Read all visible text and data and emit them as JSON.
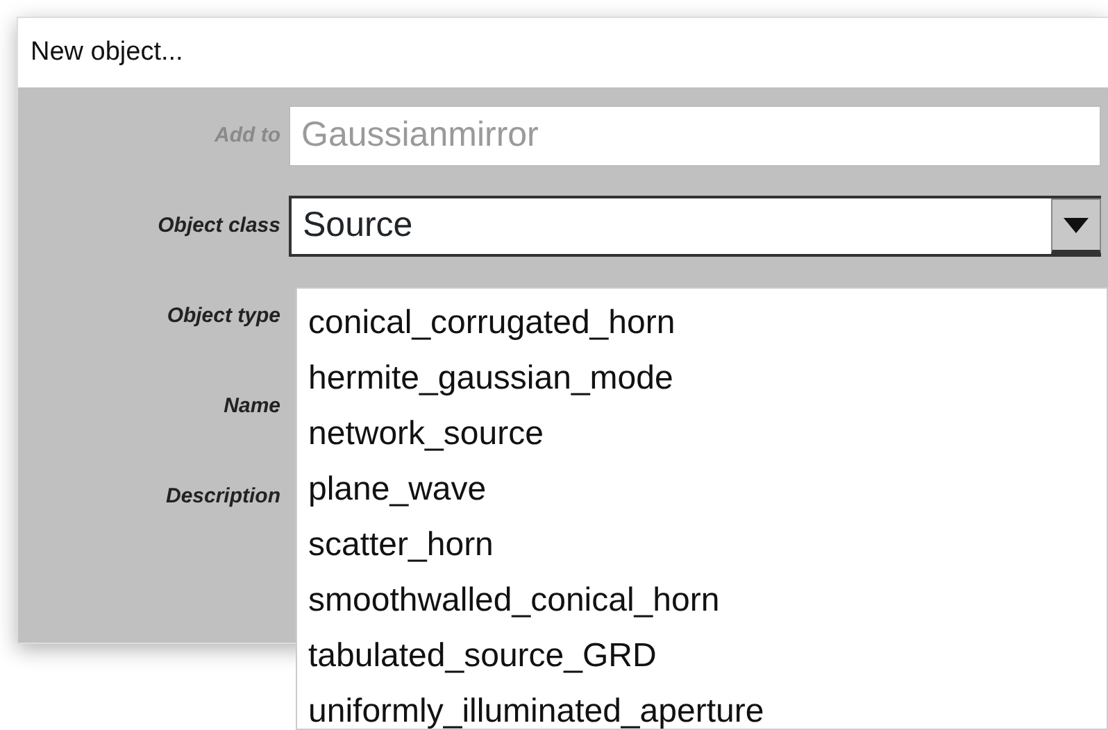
{
  "window": {
    "title": "New object..."
  },
  "fields": [
    {
      "label": "Add to",
      "kind": "text",
      "value": "Gaussianmirror",
      "disabled": true
    },
    {
      "label": "Object class",
      "kind": "select",
      "value": "Source",
      "disabled": false
    },
    {
      "label": "Object type",
      "kind": "covered",
      "disabled": false
    },
    {
      "label": "Name",
      "kind": "covered",
      "disabled": false
    },
    {
      "label": "Description",
      "kind": "covered",
      "disabled": false
    }
  ],
  "dropdown": {
    "items": [
      {
        "label": "conical_corrugated_horn",
        "selected": false
      },
      {
        "label": "hermite_gaussian_mode",
        "selected": false
      },
      {
        "label": "network_source",
        "selected": false
      },
      {
        "label": "plane_wave",
        "selected": false
      },
      {
        "label": "scatter_horn",
        "selected": false
      },
      {
        "label": "smoothwalled_conical_horn",
        "selected": false
      },
      {
        "label": "tabulated_source_GRD",
        "selected": false
      },
      {
        "label": "uniformly_illuminated_aperture",
        "selected": false
      }
    ]
  }
}
